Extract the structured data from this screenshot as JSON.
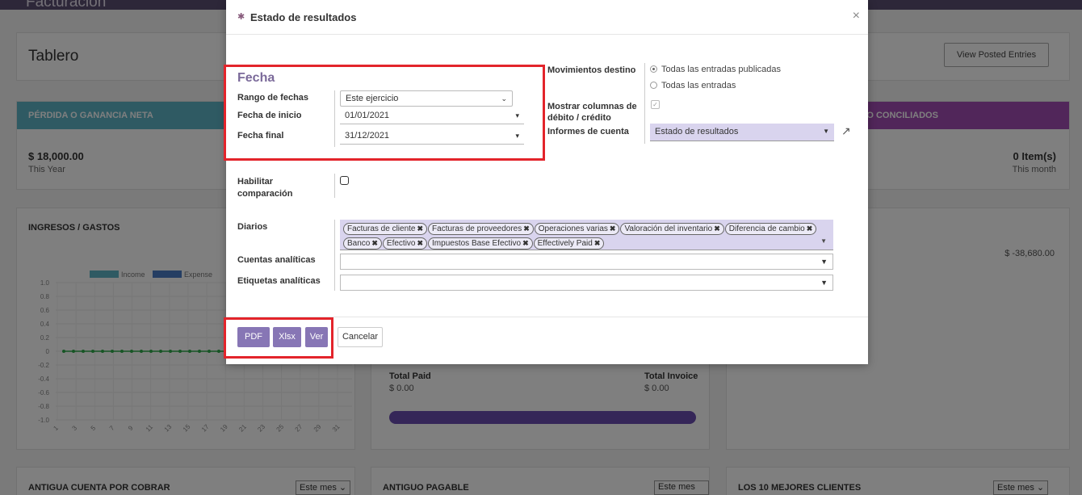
{
  "app": {
    "title": "Facturación"
  },
  "dashboard": {
    "page_title": "Tablero",
    "view_posted_label": "View Posted Entries",
    "net_card": {
      "header": "PÉRDIDA O GANANCIA NETA",
      "value": "$ 18,000.00",
      "sub": "This Year"
    },
    "unreconciled_card": {
      "header": "S NO CONCILIADOS",
      "value": "0 Item(s)",
      "sub": "This month"
    },
    "chart_card": {
      "header": "INGRESOS / GASTOS",
      "legend": [
        "Income",
        "Expense"
      ]
    },
    "right_card": {
      "amount": "$ -38,680.00"
    },
    "mid_card": {
      "total_paid_label": "Total Paid",
      "total_paid": "$ 0.00",
      "total_invoice_label": "Total Invoice",
      "total_invoice": "$ 0.00"
    },
    "bottom": [
      {
        "header": "ANTIGUA CUENTA POR COBRAR",
        "select": "Este mes"
      },
      {
        "header": "ANTIGUO PAGABLE",
        "select": "Este mes"
      },
      {
        "header": "LOS 10 MEJORES CLIENTES",
        "select": "Este mes"
      }
    ]
  },
  "chart_data": {
    "type": "line",
    "title": "",
    "xlabel": "",
    "ylabel": "",
    "x": [
      1,
      2,
      3,
      4,
      5,
      6,
      7,
      8,
      9,
      10,
      11,
      12,
      13,
      14,
      15,
      16,
      17,
      18
    ],
    "series": [
      {
        "name": "Income",
        "values": [
          0,
          0,
          0,
          0,
          0,
          0,
          0,
          0,
          0,
          0,
          0,
          0,
          0,
          0,
          0,
          0,
          0,
          0
        ]
      }
    ],
    "x_tick_labels": [
      "1",
      "3",
      "5",
      "7",
      "9",
      "11",
      "13",
      "15",
      "17",
      "19",
      "21",
      "23",
      "25",
      "27",
      "29",
      "31"
    ],
    "y_ticks": [
      "1.0",
      "0.8",
      "0.6",
      "0.4",
      "0.2",
      "0",
      "-0.2",
      "-0.4",
      "-0.6",
      "-0.8",
      "-1.0"
    ],
    "ylim": [
      -1.0,
      1.0
    ],
    "colors": {
      "income": "#5fb5c7",
      "expense": "#4a7cc7",
      "line": "#2eaa4a"
    }
  },
  "modal": {
    "title": "Estado de resultados",
    "close": "×",
    "date_section": "Fecha",
    "date_range_label": "Rango de fechas",
    "date_range_value": "Este ejercicio",
    "start_label": "Fecha de inicio",
    "start_value": "01/01/2021",
    "end_label": "Fecha final",
    "end_value": "31/12/2021",
    "target_moves_label": "Movimientos destino",
    "target_moves_options": [
      "Todas las entradas publicadas",
      "Todas las entradas"
    ],
    "debit_credit_label_1": "Mostrar columnas de",
    "debit_credit_label_2": "débito / crédito",
    "account_report_label": "Informes de cuenta",
    "account_report_value": "Estado de resultados",
    "comparison_label_1": "Habilitar",
    "comparison_label_2": "comparación",
    "journals_label": "Diarios",
    "journals": [
      "Facturas de cliente",
      "Facturas de proveedores",
      "Operaciones varias",
      "Valoración del inventario",
      "Diferencia de cambio",
      "Banco",
      "Efectivo",
      "Impuestos Base Efectivo",
      "Effectively Paid"
    ],
    "analytic_accounts_label": "Cuentas analíticas",
    "analytic_tags_label": "Etiquetas analíticas",
    "buttons": {
      "pdf": "PDF",
      "xlsx": "Xlsx",
      "view": "Ver",
      "cancel": "Cancelar"
    }
  },
  "colors": {
    "accent": "#8776b5",
    "highlight": "#e3242b"
  }
}
